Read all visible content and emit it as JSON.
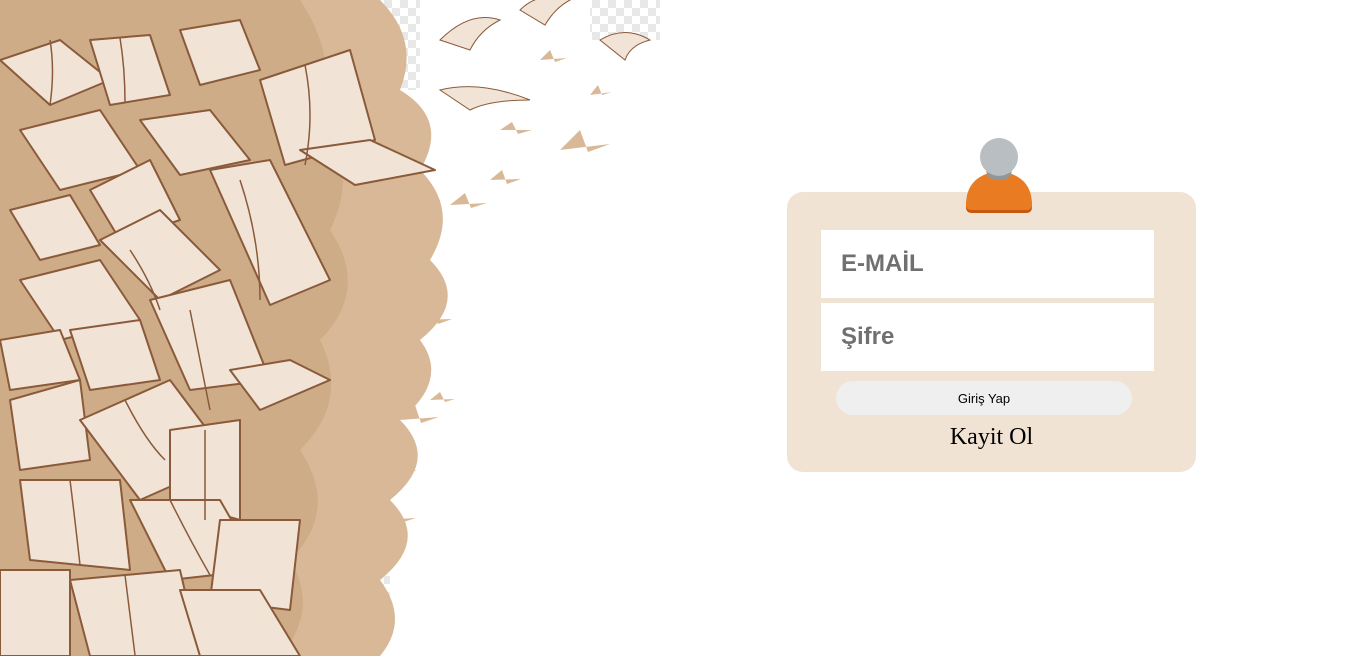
{
  "background": {
    "illustration": "flying-books-illustration"
  },
  "login": {
    "avatar_icon": "user-avatar-icon",
    "email_placeholder": "E-MAİL",
    "password_placeholder": "Şifre",
    "login_button_label": "Giriş Yap",
    "register_link_label": "Kayit Ol"
  },
  "colors": {
    "card_background": "#f0e3d4",
    "book_fill": "#f1e4d6",
    "book_outline": "#8a5a3a",
    "silhouette": "#d8b896",
    "avatar_head": "#b8bec2",
    "avatar_body": "#e97c22",
    "button_background": "#efefef"
  }
}
